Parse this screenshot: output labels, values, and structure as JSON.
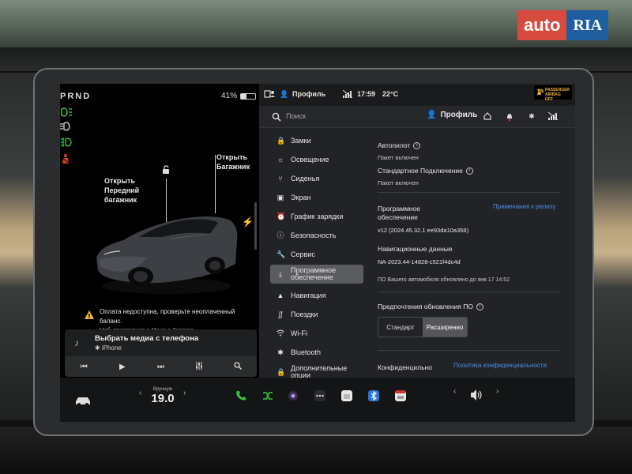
{
  "watermark": {
    "part1": "auto",
    "part2": "RIA"
  },
  "left": {
    "gear": "PRND",
    "battery": "41%",
    "battery_level": 0.41,
    "label_frunk": "Открыть\nПередний\nбагажник",
    "label_trunk": "Открыть\nБагажник",
    "warning_line1": "Оплата недоступна, проверьте неоплаченный баланс.",
    "warning_line2": "Моб. приложение > Меню > Зарядка",
    "media_title": "Выбрать медиа с телефона",
    "media_source": "✱ iPhone"
  },
  "status": {
    "profile": "Профиль",
    "time": "17:59",
    "temp": "22°C",
    "airbag_line1": "PASSENGER",
    "airbag_line2": "AIRBAG",
    "airbag_line3": "OFF"
  },
  "search": {
    "placeholder": "Поиск",
    "profile": "Профиль"
  },
  "menu": [
    {
      "label": "Замки",
      "icon": "lock-icon"
    },
    {
      "label": "Освещение",
      "icon": "sun-icon"
    },
    {
      "label": "Сиденья",
      "icon": "seat-icon"
    },
    {
      "label": "Экран",
      "icon": "display-icon"
    },
    {
      "label": "График зарядки",
      "icon": "alarm-icon"
    },
    {
      "label": "Безопасность",
      "icon": "safety-icon"
    },
    {
      "label": "Сервис",
      "icon": "wrench-icon"
    },
    {
      "label": "Программное\nобеспечение",
      "icon": "download-icon"
    },
    {
      "label": "Навигация",
      "icon": "navigation-icon"
    },
    {
      "label": "Поездки",
      "icon": "trips-icon"
    },
    {
      "label": "Wi-Fi",
      "icon": "wifi-icon"
    },
    {
      "label": "Bluetooth",
      "icon": "bluetooth-icon"
    },
    {
      "label": "Дополнительные\nопции",
      "icon": "bag-icon"
    }
  ],
  "content": {
    "autopilot_title": "Автопилот",
    "autopilot_sub": "Пакет включен",
    "connectivity_title": "Стандартное Подключение",
    "connectivity_sub": "Пакет включен",
    "software_title": "Программное\nобеспечение",
    "release_notes": "Примечания к релизу",
    "version": "v12 (2024.45.32.1 ee93da10a358)",
    "nav_data_title": "Навигационные данные",
    "nav_data_value": "NA-2023.44-14828-c521f4dc4d",
    "updated": "ПО Вашего автомобиля обновлено до янв 17 14:52",
    "update_pref_title": "Предпочтения обновления ПО",
    "opt_standard": "Стандарт",
    "opt_advanced": "Расширенно",
    "privacy_title": "Конфиденцильно",
    "privacy_link": "Политика конфиденциальности"
  },
  "dock": {
    "climate_mode": "Вручную",
    "climate_temp": "19.0",
    "arrow_left": "‹",
    "arrow_right": "›"
  }
}
